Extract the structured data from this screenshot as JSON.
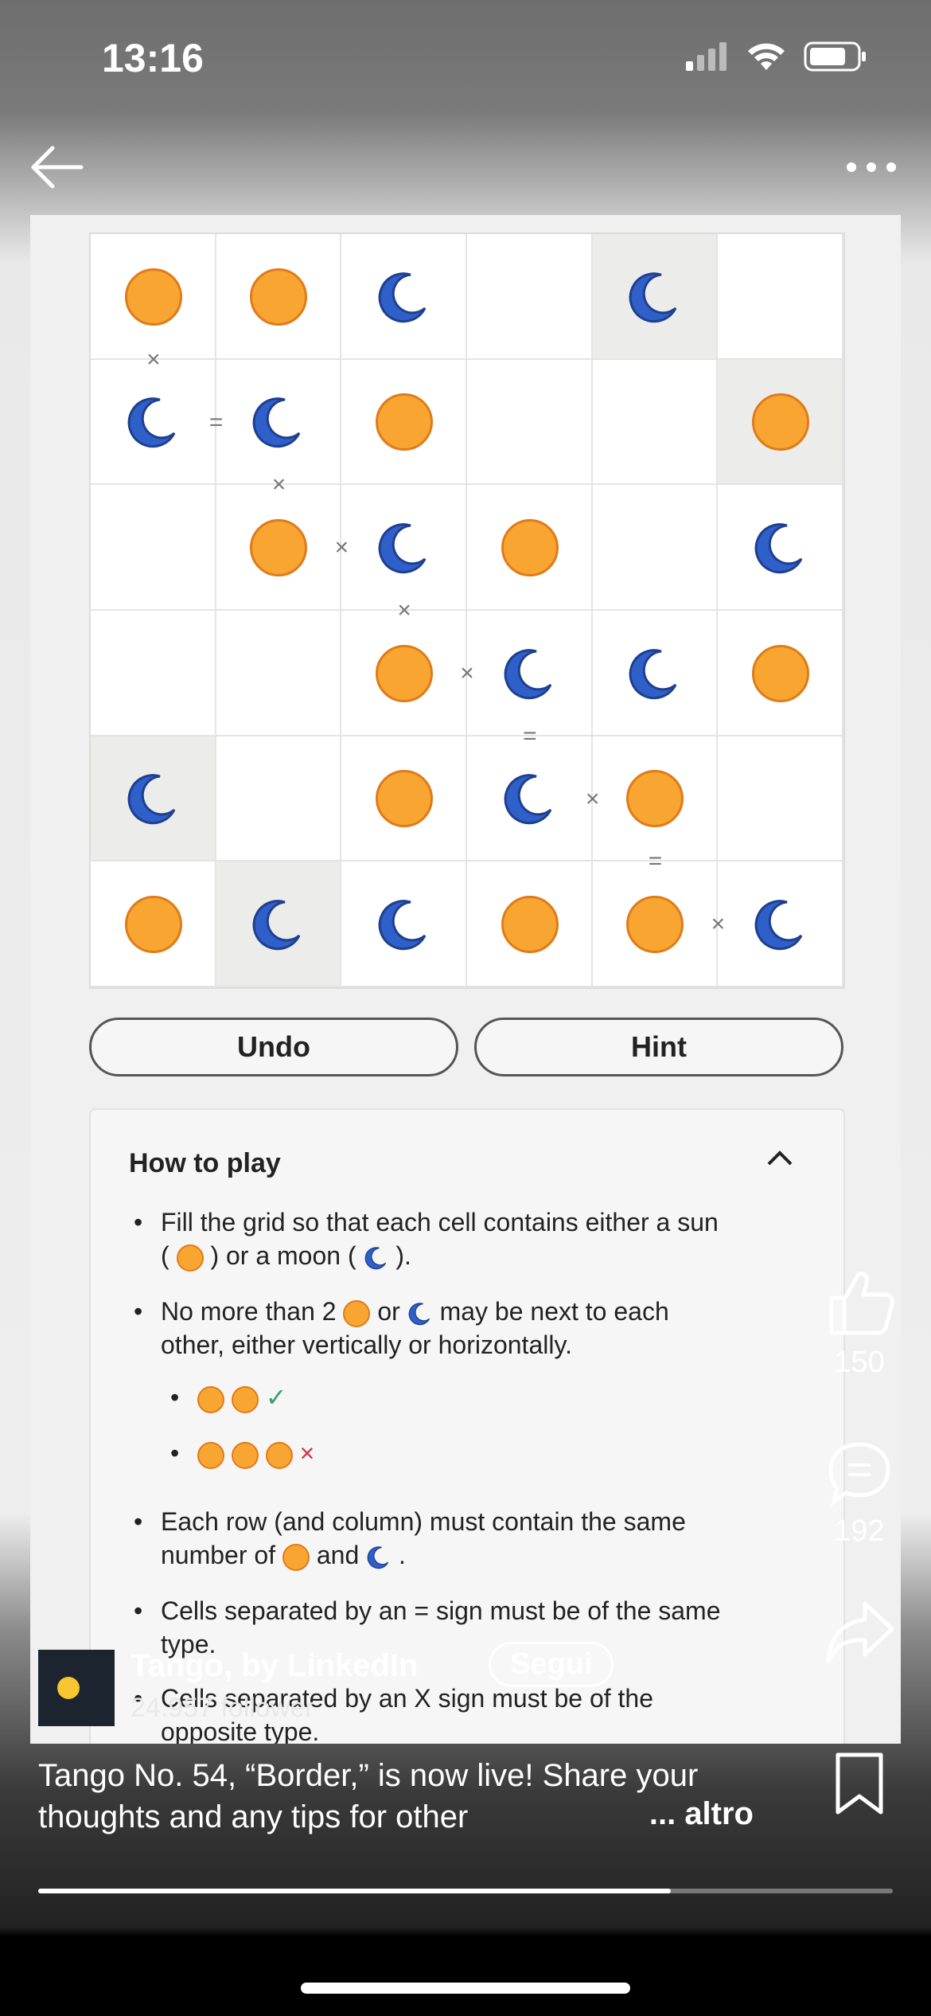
{
  "status_bar": {
    "time": "13:16"
  },
  "post": {
    "grid": {
      "rows": [
        [
          "sun",
          "sun",
          "moon",
          "",
          "moon",
          ""
        ],
        [
          "moon",
          "moon",
          "sun",
          "",
          "",
          "sun"
        ],
        [
          "",
          "sun",
          "moon",
          "sun",
          "",
          "moon"
        ],
        [
          "",
          "",
          "sun",
          "moon",
          "moon",
          "sun"
        ],
        [
          "moon",
          "",
          "sun",
          "moon",
          "sun",
          ""
        ],
        [
          "sun",
          "moon",
          "moon",
          "sun",
          "sun",
          "moon"
        ]
      ],
      "locked_cells": [
        [
          0,
          4
        ],
        [
          1,
          5
        ],
        [
          4,
          0
        ],
        [
          5,
          1
        ]
      ],
      "separators": [
        {
          "between": "v",
          "row": 0,
          "col": 0,
          "sign": "×"
        },
        {
          "between": "h",
          "row": 1,
          "col": 0,
          "sign": "="
        },
        {
          "between": "v",
          "row": 1,
          "col": 1,
          "sign": "×"
        },
        {
          "between": "h",
          "row": 2,
          "col": 1,
          "sign": "×"
        },
        {
          "between": "v",
          "row": 2,
          "col": 2,
          "sign": "×"
        },
        {
          "between": "h",
          "row": 3,
          "col": 2,
          "sign": "×"
        },
        {
          "between": "v",
          "row": 3,
          "col": 3,
          "sign": "="
        },
        {
          "between": "h",
          "row": 4,
          "col": 3,
          "sign": "×"
        },
        {
          "between": "v",
          "row": 4,
          "col": 4,
          "sign": "="
        },
        {
          "between": "h",
          "row": 5,
          "col": 4,
          "sign": "×"
        }
      ]
    },
    "buttons": {
      "undo": "Undo",
      "hint": "Hint"
    },
    "how_to_play": {
      "title": "How to play",
      "rule1_a": "Fill the grid so that each cell contains either a sun",
      "rule1_b": "(",
      "rule1_c": ") or a moon (",
      "rule1_d": ").",
      "rule2_a": "No more than 2",
      "rule2_b": "or",
      "rule2_c": "may be next to each",
      "rule2_d": "other, either vertically or horizontally.",
      "check_mark": "✓",
      "cross_mark": "×",
      "rule3_a": "Each row (and column) must contain the same",
      "rule3_b": "number of",
      "rule3_c": "and",
      "rule3_d": ".",
      "rule4_a": "Cells separated by an = sign must be of the same",
      "rule4_b": "type.",
      "rule5_a": "Cells separated by an X sign must be of the",
      "rule5_b": "opposite type."
    }
  },
  "actions": {
    "likes": "150",
    "comments": "192"
  },
  "author": {
    "name": "Tango, by LinkedIn",
    "follow": "Segui",
    "followers": "24.957 follower"
  },
  "caption": {
    "line1": "Tango No. 54, “Border,” is now live! Share your",
    "line2": "thoughts and any tips for other",
    "more": "... altro"
  },
  "video_progress": 0.74,
  "colors": {
    "sun": "#f9a531",
    "moon": "#2f5fc8",
    "accent_green": "#3aa06a",
    "accent_red": "#d2344c"
  }
}
